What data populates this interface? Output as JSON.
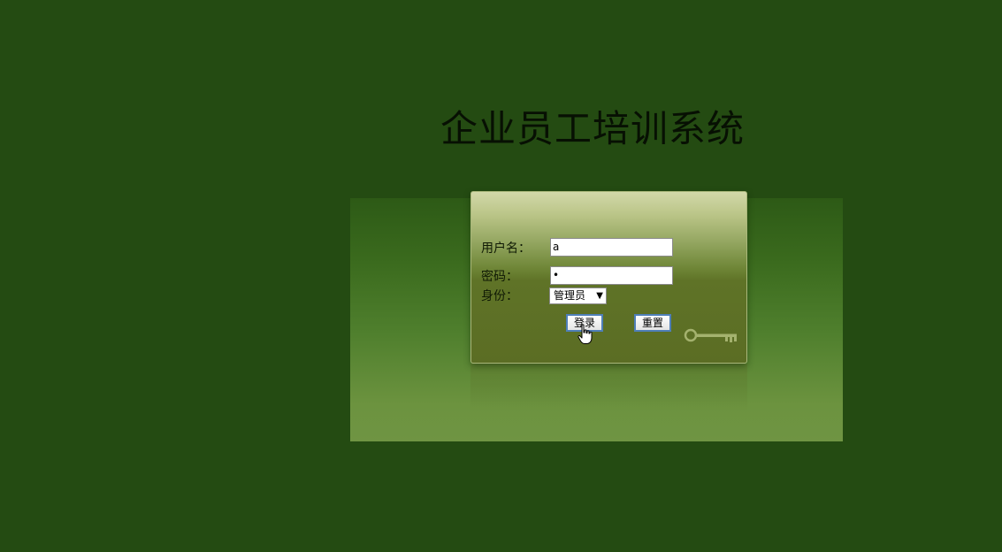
{
  "app": {
    "title": "企业员工培训系统"
  },
  "login": {
    "username_label": "用户名：",
    "username_value": "a",
    "password_label": "密码：",
    "password_value": "•",
    "role_label": "身份：",
    "role_selected": "管理员",
    "login_button": "登录",
    "reset_button": "重置"
  },
  "icons": {
    "key": "key-icon",
    "cursor": "hand-pointer-icon",
    "select_arrow": "▼"
  },
  "colors": {
    "background": "#244b12",
    "panel_top": "#d2d8a9",
    "panel_bottom": "#5b6d24",
    "button_border": "#4f7fb8"
  }
}
